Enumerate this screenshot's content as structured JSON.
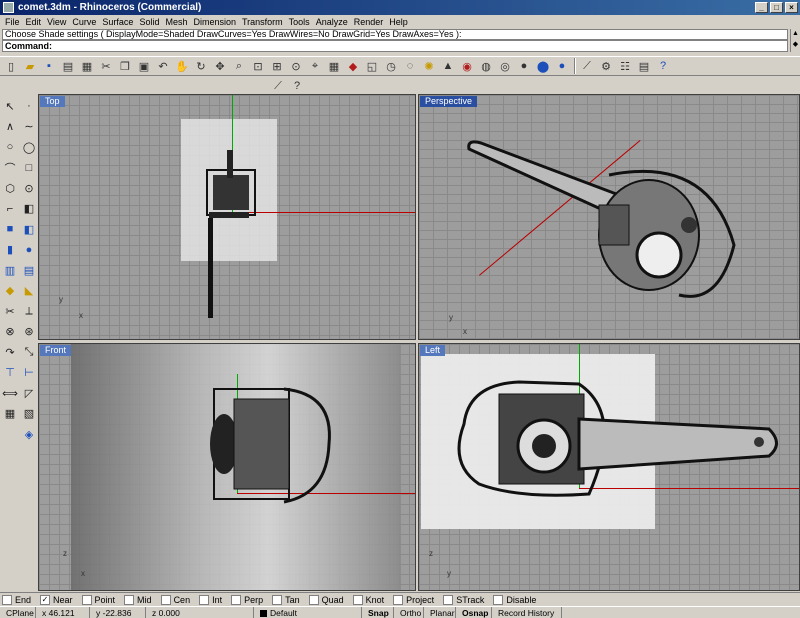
{
  "window": {
    "title": "comet.3dm - Rhinoceros (Commercial)",
    "min_glyph": "_",
    "max_glyph": "□",
    "close_glyph": "×"
  },
  "menu": [
    "File",
    "Edit",
    "View",
    "Curve",
    "Surface",
    "Solid",
    "Mesh",
    "Dimension",
    "Transform",
    "Tools",
    "Analyze",
    "Render",
    "Help"
  ],
  "command": {
    "history": "Choose Shade settings ( DisplayMode=Shaded  DrawCurves=Yes  DrawWires=No  DrawGrid=Yes  DrawAxes=Yes ):",
    "prompt": "Command:"
  },
  "viewports": {
    "top": "Top",
    "perspective": "Perspective",
    "front": "Front",
    "left": "Left"
  },
  "gizmo": {
    "x": "x",
    "y": "y",
    "z": "z"
  },
  "osnap": [
    {
      "label": "End",
      "checked": false
    },
    {
      "label": "Near",
      "checked": true
    },
    {
      "label": "Point",
      "checked": false
    },
    {
      "label": "Mid",
      "checked": false
    },
    {
      "label": "Cen",
      "checked": false
    },
    {
      "label": "Int",
      "checked": false
    },
    {
      "label": "Perp",
      "checked": false
    },
    {
      "label": "Tan",
      "checked": false
    },
    {
      "label": "Quad",
      "checked": false
    },
    {
      "label": "Knot",
      "checked": false
    },
    {
      "label": "Project",
      "checked": false
    },
    {
      "label": "STrack",
      "checked": false
    },
    {
      "label": "Disable",
      "checked": false
    }
  ],
  "status": {
    "cplane": "CPlane",
    "x": "x 46.121",
    "y": "y -22.836",
    "z": "z 0.000",
    "layer": "Default",
    "snap": "Snap",
    "ortho": "Ortho",
    "planar": "Planar",
    "osnap": "Osnap",
    "record": "Record History"
  },
  "colors": {
    "title_bar": "#0a246a",
    "viewport_bg": "#9d9d9d",
    "x_axis": "#bb0000",
    "y_axis": "#00aa00"
  }
}
